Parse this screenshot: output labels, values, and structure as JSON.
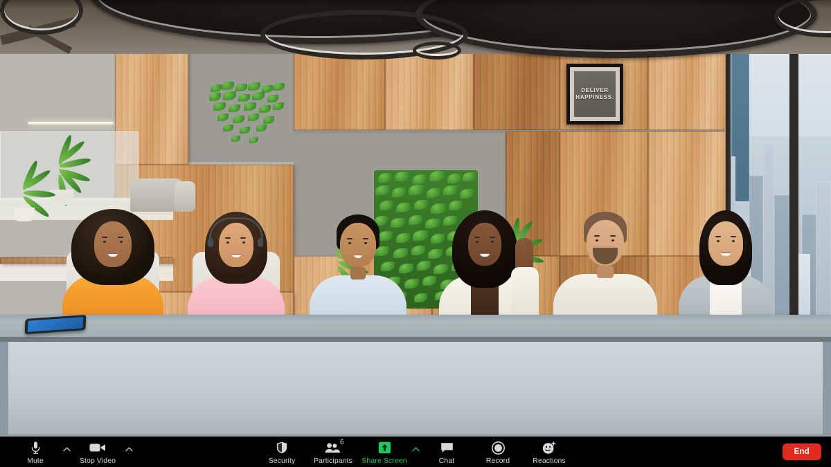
{
  "meeting": {
    "view": "Gallery video of conference room",
    "participants_shown": 6
  },
  "room": {
    "poster": {
      "line1": "DELIVER",
      "line2": "HAPPINESS."
    },
    "people": [
      {
        "name": "participant-1",
        "top_color": "#f59b27",
        "hair_color": "#221913",
        "skin": "#a8724c"
      },
      {
        "name": "participant-2",
        "top_color": "#f6c3cd",
        "hair_color": "#3a271c",
        "skin": "#d6a179",
        "headset": "yes"
      },
      {
        "name": "participant-3",
        "top_color": "#cfdce8",
        "hair_color": "#19130f",
        "skin": "#c08a5e"
      },
      {
        "name": "participant-4",
        "top_color": "#f2efe7",
        "hair_color": "#140e0a",
        "skin": "#7a4c2e"
      },
      {
        "name": "participant-5",
        "top_color": "#eceae1",
        "hair_color": "#6d5340",
        "skin": "#d8a77f"
      },
      {
        "name": "participant-6",
        "top_color": "#b9c2c6",
        "hair_color": "#130e0c",
        "skin": "#dcae88"
      }
    ]
  },
  "toolbar": {
    "background": "#000000",
    "mute": {
      "label": "Mute",
      "icon": "microphone-icon",
      "caret": "chevron-up-icon"
    },
    "video": {
      "label": "Stop Video",
      "icon": "camera-icon",
      "caret": "chevron-up-icon"
    },
    "security": {
      "label": "Security",
      "icon": "shield-icon"
    },
    "participants": {
      "label": "Participants",
      "icon": "people-icon",
      "count": "6"
    },
    "share": {
      "label": "Share Screen",
      "icon": "share-arrow-icon",
      "caret": "chevron-up-icon",
      "accent": "#1ec760"
    },
    "chat": {
      "label": "Chat",
      "icon": "chat-bubble-icon"
    },
    "record": {
      "label": "Record",
      "icon": "record-circle-icon"
    },
    "reactions": {
      "label": "Reactions",
      "icon": "smiley-plus-icon"
    },
    "end": {
      "label": "End",
      "color": "#e02b20"
    }
  }
}
